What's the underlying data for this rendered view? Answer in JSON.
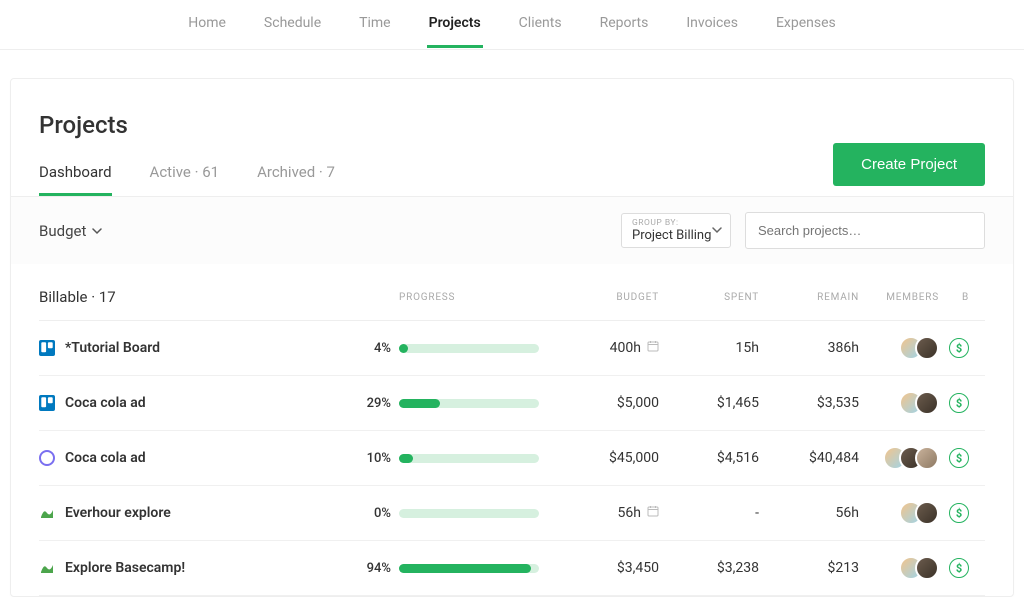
{
  "nav": {
    "items": [
      "Home",
      "Schedule",
      "Time",
      "Projects",
      "Clients",
      "Reports",
      "Invoices",
      "Expenses"
    ],
    "active_index": 3
  },
  "page": {
    "title": "Projects",
    "subtabs": {
      "dashboard": "Dashboard",
      "active": "Active · 61",
      "archived": "Archived · 7"
    },
    "create_btn": "Create Project"
  },
  "filters": {
    "budget_label": "Budget",
    "groupby_label": "GROUP BY:",
    "groupby_value": "Project Billing",
    "search_placeholder": "Search projects…"
  },
  "columns": {
    "progress": "PROGRESS",
    "budget": "BUDGET",
    "spent": "SPENT",
    "remain": "REMAIN",
    "members": "MEMBERS",
    "b": "B"
  },
  "section": {
    "title": "Billable · 17"
  },
  "rows": [
    {
      "icon": "trello",
      "name": "*Tutorial Board",
      "pct": "4%",
      "pct_num": 4,
      "budget": "400h",
      "budget_has_cal": true,
      "spent": "15h",
      "remain": "386h",
      "members": 2
    },
    {
      "icon": "trello",
      "name": "Coca cola ad",
      "pct": "29%",
      "pct_num": 29,
      "budget": "$5,000",
      "budget_has_cal": false,
      "spent": "$1,465",
      "remain": "$3,535",
      "members": 2
    },
    {
      "icon": "asana",
      "name": "Coca cola ad",
      "pct": "10%",
      "pct_num": 10,
      "budget": "$45,000",
      "budget_has_cal": false,
      "spent": "$4,516",
      "remain": "$40,484",
      "members": 3
    },
    {
      "icon": "basecamp",
      "name": "Everhour explore",
      "pct": "0%",
      "pct_num": 0,
      "budget": "56h",
      "budget_has_cal": true,
      "spent": "-",
      "remain": "56h",
      "members": 2
    },
    {
      "icon": "basecamp",
      "name": "Explore Basecamp!",
      "pct": "94%",
      "pct_num": 94,
      "budget": "$3,450",
      "budget_has_cal": false,
      "spent": "$3,238",
      "remain": "$213",
      "members": 2
    }
  ]
}
